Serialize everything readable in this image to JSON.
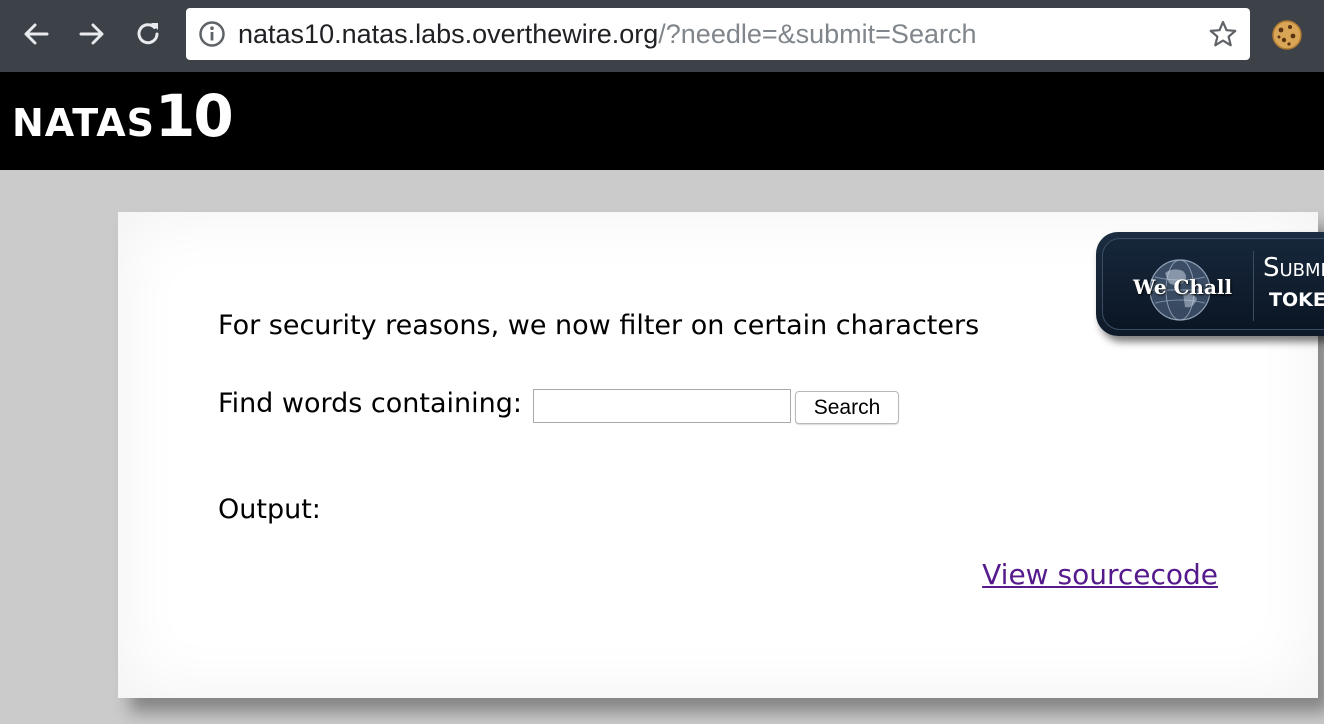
{
  "browser": {
    "url_host": "natas10.natas.labs.overthewire.org",
    "url_path": "/?needle=&submit=Search",
    "icons": {
      "back": "back-arrow-icon",
      "forward": "forward-arrow-icon",
      "reload": "reload-icon",
      "info": "info-icon",
      "bookmark": "star-icon",
      "extension": "cookie-icon"
    }
  },
  "header": {
    "title_word": "NATAS",
    "title_number": "10"
  },
  "content": {
    "notice": "For security reasons, we now filter on certain characters",
    "search_label": "Find words containing:",
    "search_value": "",
    "search_button": "Search",
    "output_label": "Output:",
    "source_link": "View sourcecode"
  },
  "badge": {
    "name": "We Chall",
    "submit_text": "Submit",
    "token_text": "TOKEN"
  },
  "colors": {
    "toolbar": "#3d4249",
    "page_background": "#cbcbcb",
    "header_background": "#000000",
    "link_visited": "#551a8b",
    "badge_background": "#16273b"
  }
}
